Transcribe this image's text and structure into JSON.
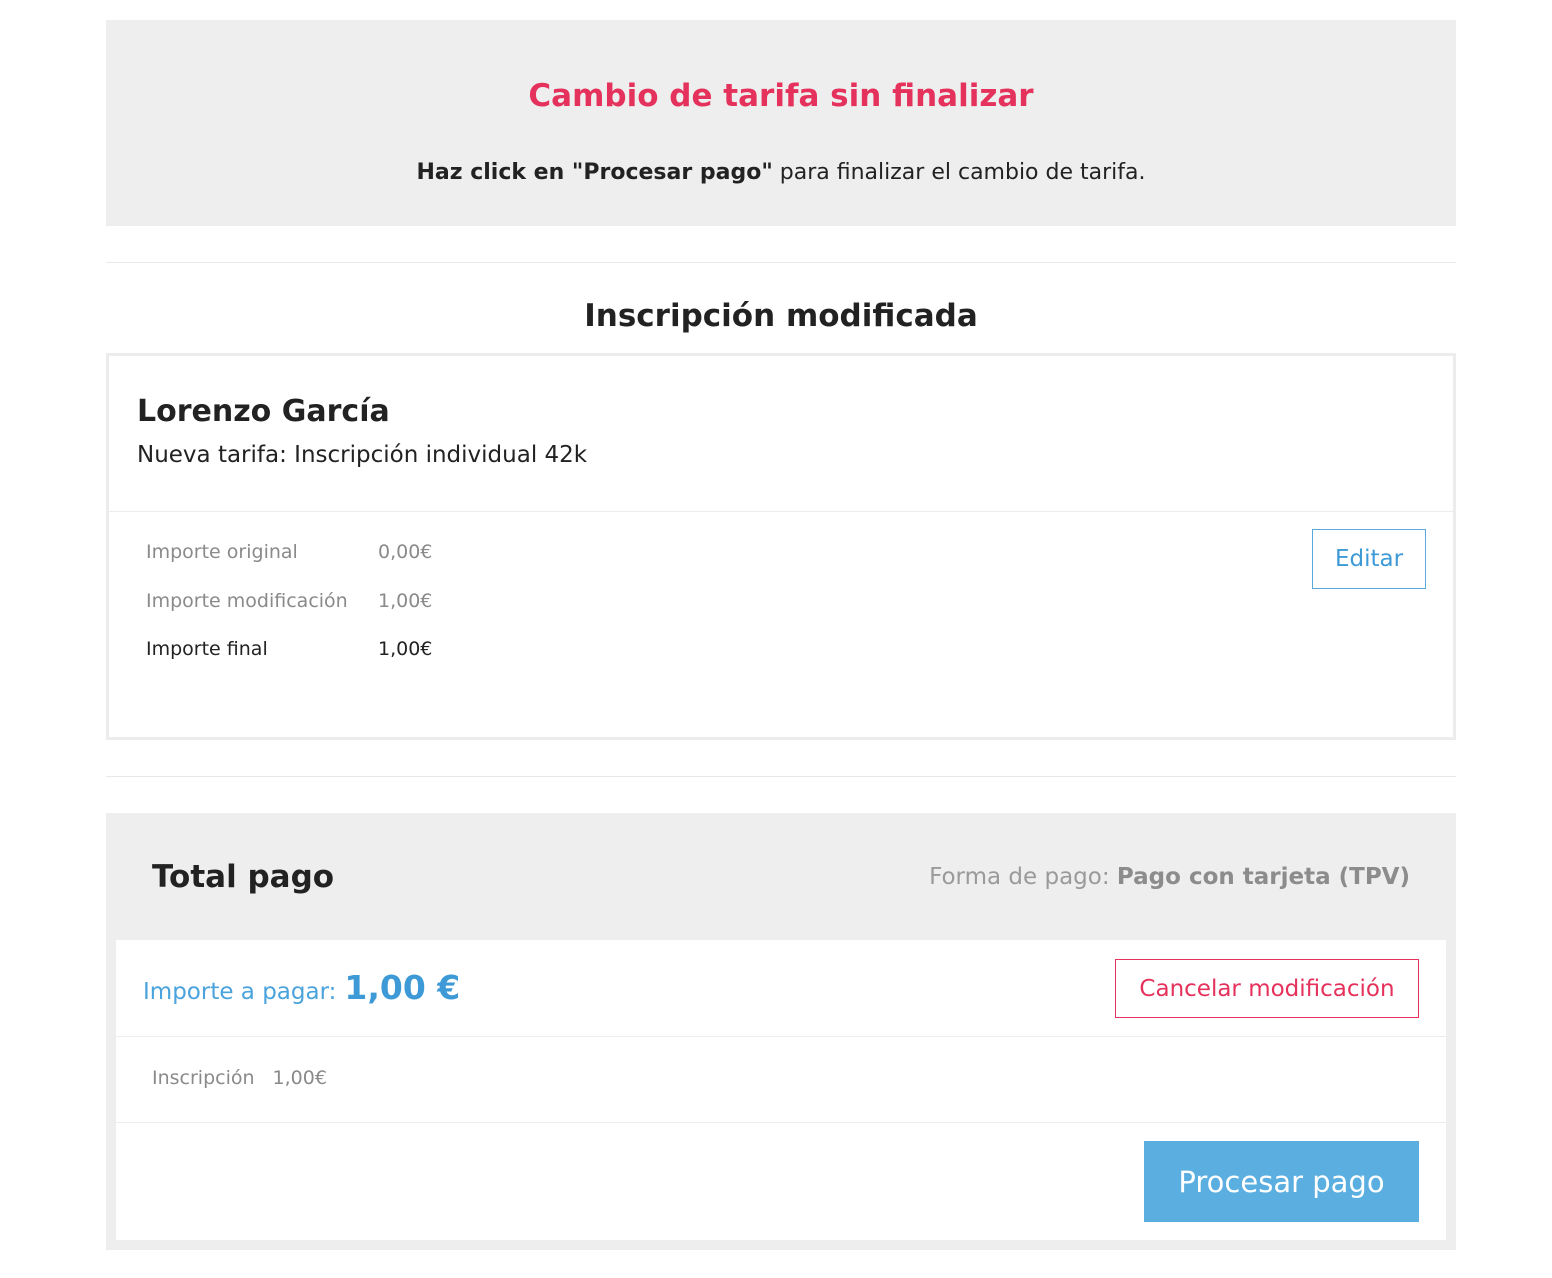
{
  "alert": {
    "title": "Cambio de tarifa sin finalizar",
    "message_bold": "Haz click en \"Procesar pago\"",
    "message_rest": " para finalizar el cambio de tarifa."
  },
  "section": {
    "title": "Inscripción modificada"
  },
  "registration": {
    "name": "Lorenzo García",
    "new_rate": "Nueva tarifa: Inscripción individual 42k",
    "amounts": [
      {
        "label": "Importe original",
        "value": "0,00€"
      },
      {
        "label": "Importe modificación",
        "value": "1,00€"
      },
      {
        "label": "Importe final",
        "value": "1,00€"
      }
    ],
    "edit_label": "Editar"
  },
  "total": {
    "title": "Total pago",
    "payment_method_label": "Forma de pago: ",
    "payment_method_value": "Pago con tarjeta (TPV)",
    "amount_due_label": "Importe a pagar:",
    "amount_due_value": "1,00 €",
    "cancel_label": "Cancelar modificación",
    "line_item_label": "Inscripción",
    "line_item_value": "1,00€",
    "process_label": "Procesar pago"
  },
  "colors": {
    "accent_red": "#e5325c",
    "accent_blue": "#3d9ad6",
    "button_blue": "#5aaee0",
    "panel_gray": "#eeeeee"
  }
}
